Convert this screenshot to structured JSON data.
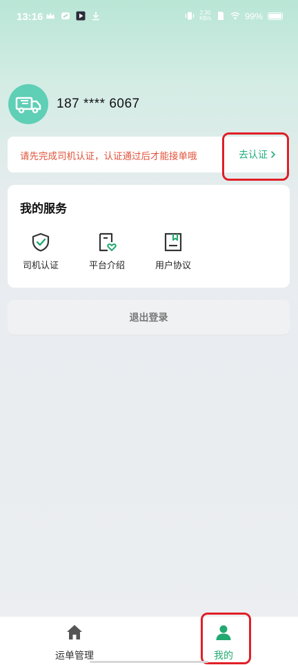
{
  "status_bar": {
    "time": "13:16",
    "net_speed_value": "2.30",
    "net_speed_unit": "KB/s",
    "battery_percent": "99%"
  },
  "profile": {
    "phone": "187 **** 6067"
  },
  "notice": {
    "message": "请先完成司机认证，认证通过后才能接单哦",
    "action_label": "去认证",
    "message_color": "#e0533b",
    "action_color": "#1fae7d"
  },
  "services": {
    "title": "我的服务",
    "items": [
      {
        "label": "司机认证",
        "icon": "shield-check-icon"
      },
      {
        "label": "平台介绍",
        "icon": "document-heart-icon"
      },
      {
        "label": "用户协议",
        "icon": "bookmark-book-icon"
      }
    ]
  },
  "logout": {
    "label": "退出登录"
  },
  "tabbar": {
    "items": [
      {
        "label": "运单管理",
        "icon": "home-icon",
        "active": false
      },
      {
        "label": "我的",
        "icon": "person-icon",
        "active": true
      }
    ],
    "active_color": "#21a96f",
    "inactive_color": "#333333"
  },
  "colors": {
    "accent": "#21a96f",
    "highlight_box": "#e01e25"
  }
}
